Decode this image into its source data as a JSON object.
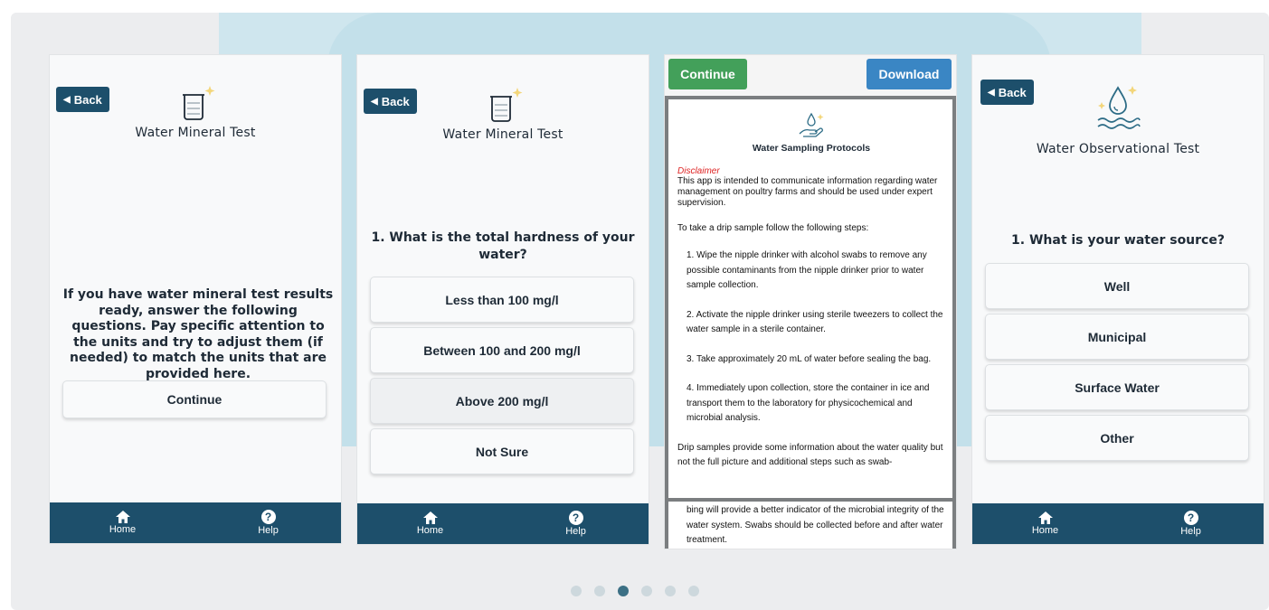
{
  "phone1": {
    "back_label": "Back",
    "title": "Water Mineral Test",
    "intro": "If you have water mineral test results ready, answer the following questions. Pay specific attention to the units and try to adjust them (if needed) to match the units that are provided here.",
    "continue_label": "Continue"
  },
  "phone2": {
    "back_label": "Back",
    "title": "Water Mineral Test",
    "question": "1. What is the total hardness of your water?",
    "options": [
      "Less than 100 mg/l",
      "Between 100 and 200 mg/l",
      "Above 200 mg/l",
      "Not Sure"
    ]
  },
  "phone3": {
    "continue_label": "Continue",
    "download_label": "Download",
    "doc_title": "Water Sampling Protocols",
    "disclaimer_label": "Disclaimer",
    "disclaimer_text": "This app is intended to communicate information regarding water management on poultry farms and should be used under expert supervision.",
    "intro": "To take a drip sample follow the following steps:",
    "steps": [
      "1. Wipe the nipple drinker with alcohol swabs to remove any possible contaminants from the nipple drinker prior to water sample collection.",
      "2. Activate the nipple drinker using sterile tweezers to collect the water sample in a sterile container.",
      "3. Take approximately 20 mL of water before sealing the bag.",
      "4. Immediately upon collection, store the container in ice and transport them to the laboratory for physicochemical and microbial analysis."
    ],
    "closing": "Drip samples provide some information about the water quality but not the full picture and additional steps such as swab-",
    "continuation": "bing will provide a better indicator of the microbial integrity of the water system. Swabs should be collected before and after water treatment."
  },
  "phone4": {
    "back_label": "Back",
    "title": "Water Observational Test",
    "question": "1. What is your water source?",
    "options": [
      "Well",
      "Municipal",
      "Surface Water",
      "Other"
    ]
  },
  "tabbar": {
    "home_label": "Home",
    "help_label": "Help"
  },
  "carousel": {
    "total": 6,
    "active_index": 2
  },
  "icons": {
    "back": "back-arrow-icon",
    "beaker": "beaker-icon",
    "hand_drop": "hand-water-drop-icon",
    "water_drop": "water-drop-waves-icon",
    "home": "home-icon",
    "help": "help-icon"
  },
  "colors": {
    "navy": "#1d4f6b",
    "green": "#43a05a",
    "blue": "#3a86c4",
    "disclaimer_red": "#d22222",
    "sparkle": "#f3d67a"
  }
}
